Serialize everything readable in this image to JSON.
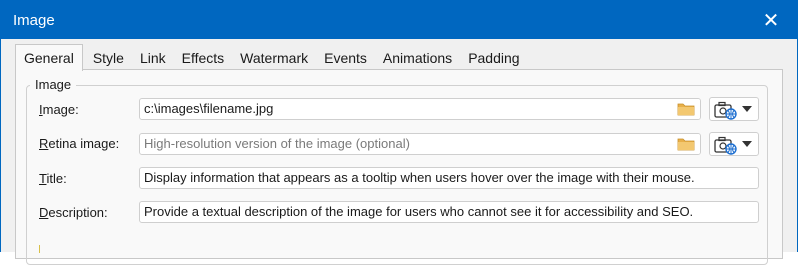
{
  "window": {
    "title": "Image",
    "close_glyph": "✕"
  },
  "tabs": [
    {
      "label": "General",
      "active": true
    },
    {
      "label": "Style"
    },
    {
      "label": "Link"
    },
    {
      "label": "Effects"
    },
    {
      "label": "Watermark"
    },
    {
      "label": "Events"
    },
    {
      "label": "Animations"
    },
    {
      "label": "Padding"
    }
  ],
  "group": {
    "legend": "Image"
  },
  "fields": {
    "image": {
      "label_u": "I",
      "label_rest": "mage:",
      "value": "c:\\images\\filename.jpg"
    },
    "retina": {
      "label_u": "R",
      "label_rest": "etina image:",
      "placeholder": "High-resolution version of the image (optional)"
    },
    "title": {
      "label_u": "T",
      "label_rest": "itle:",
      "value": "Display information that appears as a tooltip when users hover over the image with their mouse."
    },
    "description": {
      "label_u": "D",
      "label_rest": "escription:",
      "value": "Provide a textual description of the image for users who cannot see it for accessibility and SEO."
    }
  },
  "colors": {
    "titlebar": "#0067c0",
    "folder": "#e8b04a",
    "globe": "#1e6fd0"
  },
  "icons": {
    "browse": "folder-icon",
    "source": "camera-globe-icon",
    "dropdown": "chevron-down-icon",
    "close": "close-icon"
  }
}
